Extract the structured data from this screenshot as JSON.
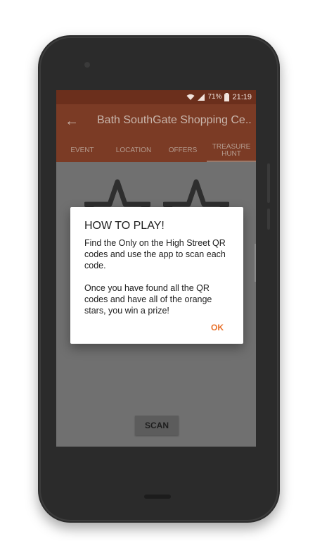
{
  "status_bar": {
    "battery": "71%",
    "time": "21:19",
    "wifi_icon": "wifi-icon",
    "signal_icon": "signal-icon"
  },
  "app_bar": {
    "title": "Bath SouthGate Shopping Ce...",
    "back_icon": "arrow-left-icon"
  },
  "tabs": [
    {
      "label": "EVENT"
    },
    {
      "label": "LOCATION"
    },
    {
      "label": "OFFERS"
    },
    {
      "label": "TREASURE HUNT",
      "active": true
    }
  ],
  "content": {
    "scan_label": "SCAN"
  },
  "dialog": {
    "title": "HOW TO PLAY!",
    "paragraphs": [
      "Find the Only on the High Street QR codes and use the app to scan each code.",
      "Once you have found all the QR codes and have all of the orange stars, you win a prize!"
    ],
    "ok_label": "OK"
  },
  "colors": {
    "status_bar": "#6b2f1c",
    "app_bar": "#7b3b25",
    "accent": "#e8702a",
    "screen_dim": "#707070"
  }
}
